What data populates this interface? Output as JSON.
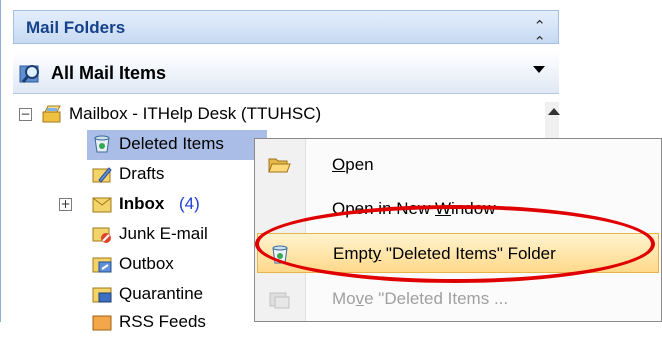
{
  "pane": {
    "title": "Mail Folders",
    "all_items_label": "All Mail Items"
  },
  "tree": {
    "mailbox": "Mailbox - ITHelp Desk (TTUHSC)",
    "folders": [
      {
        "label": "Deleted Items",
        "selected": true
      },
      {
        "label": "Drafts"
      },
      {
        "label": "Inbox",
        "count": "(4)"
      },
      {
        "label": "Junk E-mail"
      },
      {
        "label": "Outbox"
      },
      {
        "label": "Quarantine"
      },
      {
        "label": "RSS Feeds"
      }
    ]
  },
  "context_menu": {
    "items": [
      {
        "label_pre": "",
        "mnemonic": "O",
        "label_post": "pen"
      },
      {
        "label_pre": "Open in New ",
        "mnemonic": "W",
        "label_post": "indow"
      },
      {
        "label_pre": "Empt",
        "mnemonic": "y",
        "label_post": " \"Deleted Items\" Folder"
      },
      {
        "label_pre": "Mo",
        "mnemonic": "v",
        "label_post": "e \"Deleted Items ..."
      }
    ]
  },
  "colors": {
    "accent": "#15428b",
    "selection": "#a9bde6",
    "highlight_ring": "#e00000",
    "menu_hover": "#ffd98a"
  }
}
